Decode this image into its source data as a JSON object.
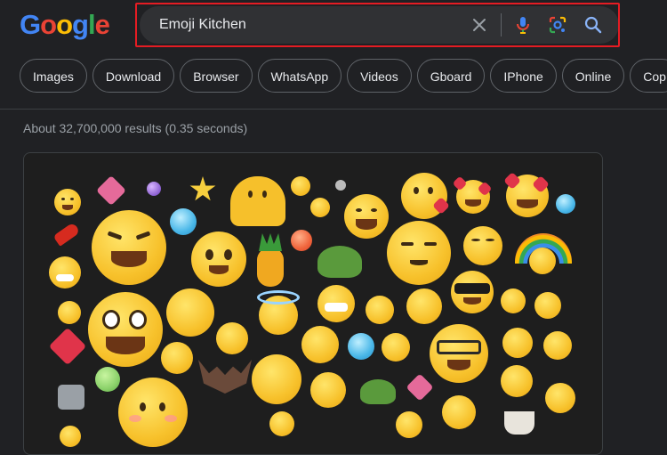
{
  "logo": {
    "letters": [
      "G",
      "o",
      "o",
      "g",
      "l",
      "e"
    ],
    "colors": [
      "#4285f4",
      "#ea4335",
      "#fbbc05",
      "#4285f4",
      "#34a853",
      "#ea4335"
    ]
  },
  "search": {
    "query": "Emoji Kitchen",
    "icons": [
      "close-icon",
      "microphone-icon",
      "google-lens-icon",
      "search-icon"
    ],
    "highlight_color": "#e51c23"
  },
  "filter_chips": [
    "Images",
    "Download",
    "Browser",
    "WhatsApp",
    "Videos",
    "Gboard",
    "IPhone",
    "Online",
    "Cop"
  ],
  "results": {
    "stats": "About 32,700,000 results (0.35 seconds)"
  },
  "image_panel": {
    "content": "emoji kitchen emoji mashup collage"
  },
  "colors": {
    "background": "#202124",
    "search_box": "#303134",
    "chip_border": "#5f6368",
    "text_primary": "#e8eaed",
    "text_secondary": "#9aa0a6"
  }
}
